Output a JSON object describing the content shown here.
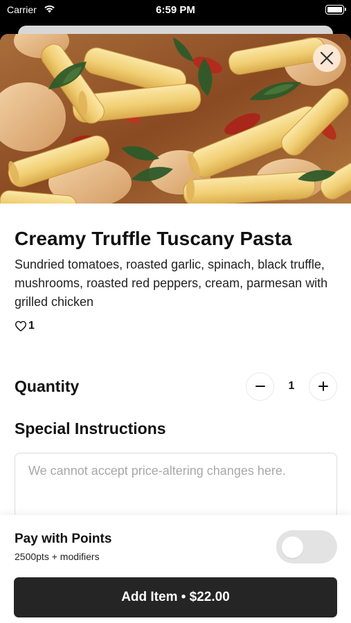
{
  "status_bar": {
    "carrier": "Carrier",
    "time": "6:59 PM",
    "icons": [
      "wifi-icon",
      "battery-icon"
    ]
  },
  "item": {
    "image": "pasta-photo",
    "name": "Creamy Truffle Tuscany Pasta",
    "description": "Sundried tomatoes, roasted garlic, spinach, black truffle, mushrooms, roasted red peppers, cream, parmesan with grilled chicken",
    "likes": "1"
  },
  "quantity": {
    "label": "Quantity",
    "value": "1"
  },
  "special_instructions": {
    "label": "Special Instructions",
    "value": "",
    "placeholder": "We cannot accept price-altering changes here."
  },
  "points": {
    "title": "Pay with Points",
    "subtitle": "2500pts + modifiers",
    "enabled": false
  },
  "add_button": {
    "label": "Add Item • $22.00"
  },
  "colors": {
    "button_bg": "#252525",
    "toggle_off": "#e3e3e3",
    "close_bg": "#ffecdc"
  }
}
